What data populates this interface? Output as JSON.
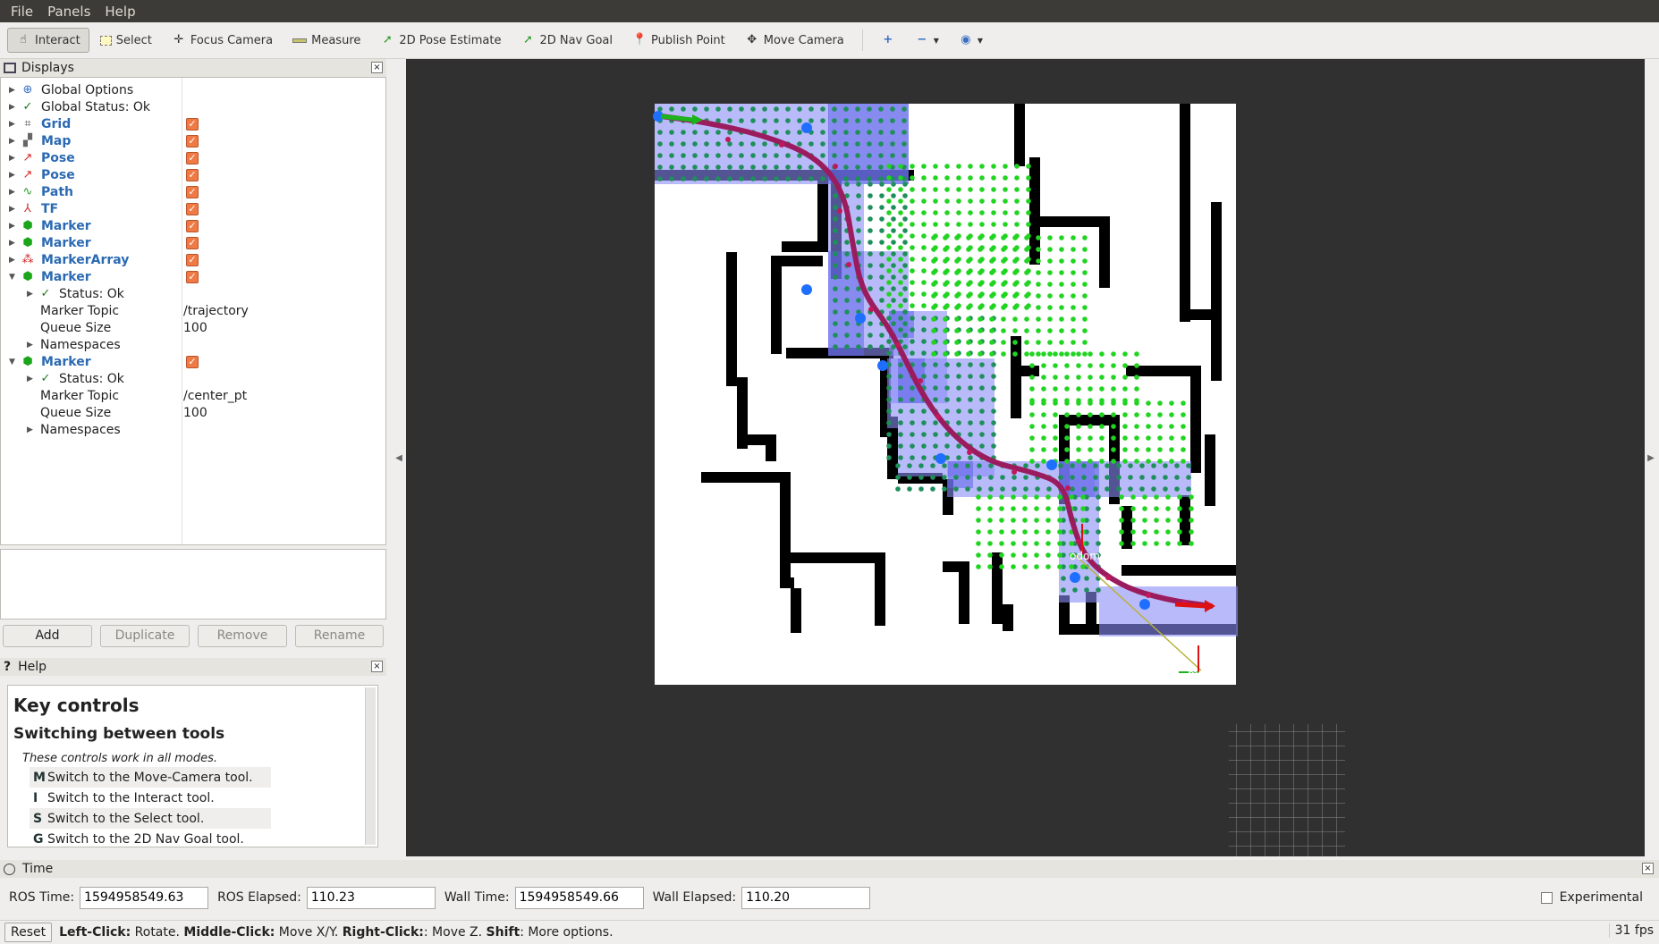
{
  "menu": {
    "file": "File",
    "panels": "Panels",
    "help": "Help"
  },
  "toolbar": {
    "interact": "Interact",
    "select": "Select",
    "focus_camera": "Focus Camera",
    "measure": "Measure",
    "pose_estimate": "2D Pose Estimate",
    "nav_goal": "2D Nav Goal",
    "publish_point": "Publish Point",
    "move_camera": "Move Camera"
  },
  "displays": {
    "title": "Displays",
    "items": [
      {
        "label": "Global Options",
        "icon": "globe-icon",
        "checked": false
      },
      {
        "label": "Global Status: Ok",
        "icon": "check-icon",
        "checked": false
      },
      {
        "label": "Grid",
        "icon": "grid-icon",
        "checked": true
      },
      {
        "label": "Map",
        "icon": "map-icon",
        "checked": true
      },
      {
        "label": "Pose",
        "icon": "pose-arrow-icon",
        "checked": true
      },
      {
        "label": "Pose",
        "icon": "pose-arrow-icon",
        "checked": true
      },
      {
        "label": "Path",
        "icon": "path-icon",
        "checked": true
      },
      {
        "label": "TF",
        "icon": "tf-icon",
        "checked": true
      },
      {
        "label": "Marker",
        "icon": "marker-cube-icon",
        "checked": true
      },
      {
        "label": "Marker",
        "icon": "marker-cube-icon",
        "checked": true
      },
      {
        "label": "MarkerArray",
        "icon": "marker-array-icon",
        "checked": true
      },
      {
        "label": "Marker",
        "icon": "marker-cube-icon",
        "checked": true
      },
      {
        "label": "Marker",
        "icon": "marker-cube-icon",
        "checked": true
      }
    ],
    "marker1": {
      "status": "Status: Ok",
      "topic_label": "Marker Topic",
      "topic": "/trajectory",
      "queue_label": "Queue Size",
      "queue": "100",
      "ns": "Namespaces"
    },
    "marker2": {
      "status": "Status: Ok",
      "topic_label": "Marker Topic",
      "topic": "/center_pt",
      "queue_label": "Queue Size",
      "queue": "100",
      "ns": "Namespaces"
    }
  },
  "buttons": {
    "add": "Add",
    "duplicate": "Duplicate",
    "remove": "Remove",
    "rename": "Rename"
  },
  "help": {
    "title": "Help",
    "heading": "Key controls",
    "subheading": "Switching between tools",
    "note": "These controls work in all modes.",
    "keys": [
      {
        "key": "M",
        "text": "Switch to the Move-Camera tool."
      },
      {
        "key": "I",
        "text": "Switch to the Interact tool."
      },
      {
        "key": "S",
        "text": "Switch to the Select tool."
      },
      {
        "key": "G",
        "text": "Switch to the 2D Nav Goal tool."
      }
    ]
  },
  "viewport": {
    "frame_odom": "odom",
    "frame_map": "map"
  },
  "time": {
    "title": "Time",
    "ros_time_label": "ROS Time:",
    "ros_time": "1594958549.63",
    "ros_elapsed_label": "ROS Elapsed:",
    "ros_elapsed": "110.23",
    "wall_time_label": "Wall Time:",
    "wall_time": "1594958549.66",
    "wall_elapsed_label": "Wall Elapsed:",
    "wall_elapsed": "110.20",
    "experimental": "Experimental"
  },
  "status": {
    "reset": "Reset",
    "h1": "Left-Click:",
    "t1": " Rotate. ",
    "h2": "Middle-Click:",
    "t2": " Move X/Y. ",
    "h3": "Right-Click:",
    "t3": ": Move Z. ",
    "h4": "Shift",
    "t4": ": More options.",
    "fps": "31 fps"
  },
  "colors": {
    "accent": "#2b6ab3",
    "checkbox": "#ef7a45",
    "path": "#9b1c5e",
    "coverage": "#8a8cf5",
    "viewport_bg": "#303030"
  }
}
